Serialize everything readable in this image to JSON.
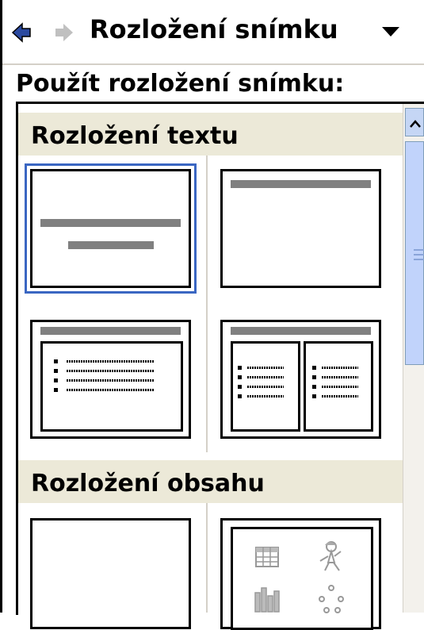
{
  "pane": {
    "title": "Rozložení snímku",
    "back_icon": "arrow-left-icon",
    "forward_icon": "arrow-right-icon",
    "menu_icon": "dropdown-triangle-icon"
  },
  "apply_label": "Použít rozložení snímku:",
  "sections": [
    {
      "label": "Rozložení textu"
    },
    {
      "label": "Rozložení obsahu"
    }
  ],
  "icons": {
    "table": "table-icon",
    "clipart": "clipart-person-icon",
    "chart": "chart-icon",
    "diagram": "diagram-icon"
  },
  "colors": {
    "selection": "#3a66c2",
    "section_bg": "#ece9d8",
    "placeholder_bar": "#808080",
    "scrollbar_thumb": "#c1d3fb"
  }
}
